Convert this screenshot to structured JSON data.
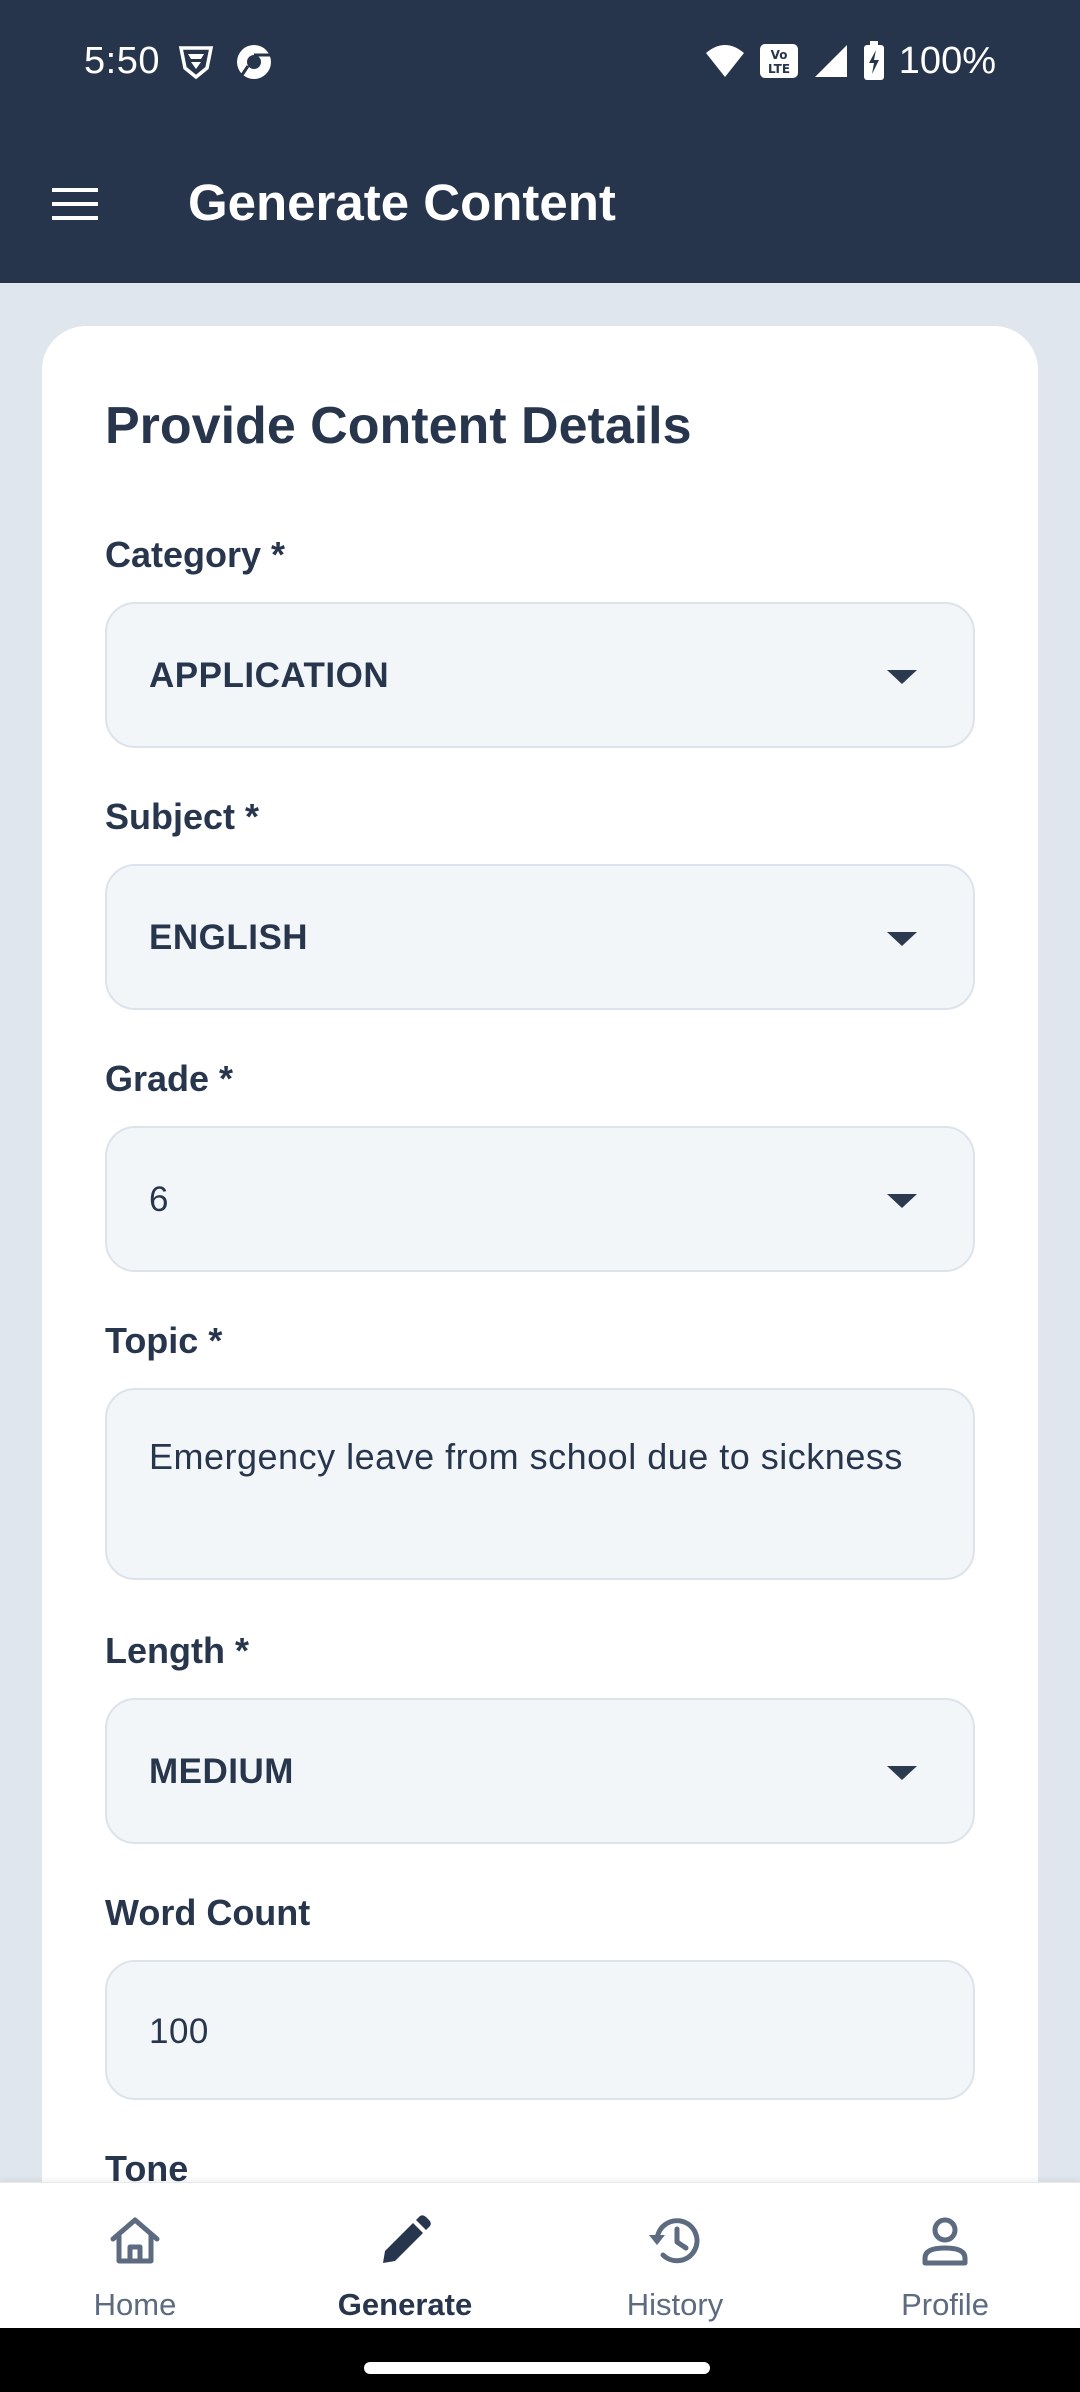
{
  "status_bar": {
    "time": "5:50",
    "battery": "100%",
    "icons": [
      "vpn-shield-icon",
      "chrome-logo-icon",
      "wifi-icon",
      "volte-icon",
      "cell-signal-icon",
      "battery-charging-icon"
    ]
  },
  "app_bar": {
    "title": "Generate Content",
    "menu_icon": "hamburger-menu-icon"
  },
  "form": {
    "heading": "Provide Content Details",
    "category": {
      "label": "Category *",
      "value": "APPLICATION"
    },
    "subject": {
      "label": "Subject *",
      "value": "ENGLISH"
    },
    "grade": {
      "label": "Grade *",
      "value": "6"
    },
    "topic": {
      "label": "Topic *",
      "value": "Emergency leave from school due to sickness"
    },
    "length": {
      "label": "Length *",
      "value": "MEDIUM"
    },
    "word_count": {
      "label": "Word Count",
      "value": "100"
    },
    "tone": {
      "label": "Tone"
    }
  },
  "bottom_nav": {
    "items": [
      {
        "label": "Home",
        "icon": "home-icon",
        "active": false
      },
      {
        "label": "Generate",
        "icon": "pencil-icon",
        "active": true
      },
      {
        "label": "History",
        "icon": "history-icon",
        "active": false
      },
      {
        "label": "Profile",
        "icon": "person-icon",
        "active": false
      }
    ]
  },
  "colors": {
    "app_bar_bg": "#26354c",
    "page_bg": "#dfe6ed",
    "field_bg": "#f3f6f9",
    "text_primary": "#27364d",
    "nav_inactive": "#5c6b80"
  }
}
